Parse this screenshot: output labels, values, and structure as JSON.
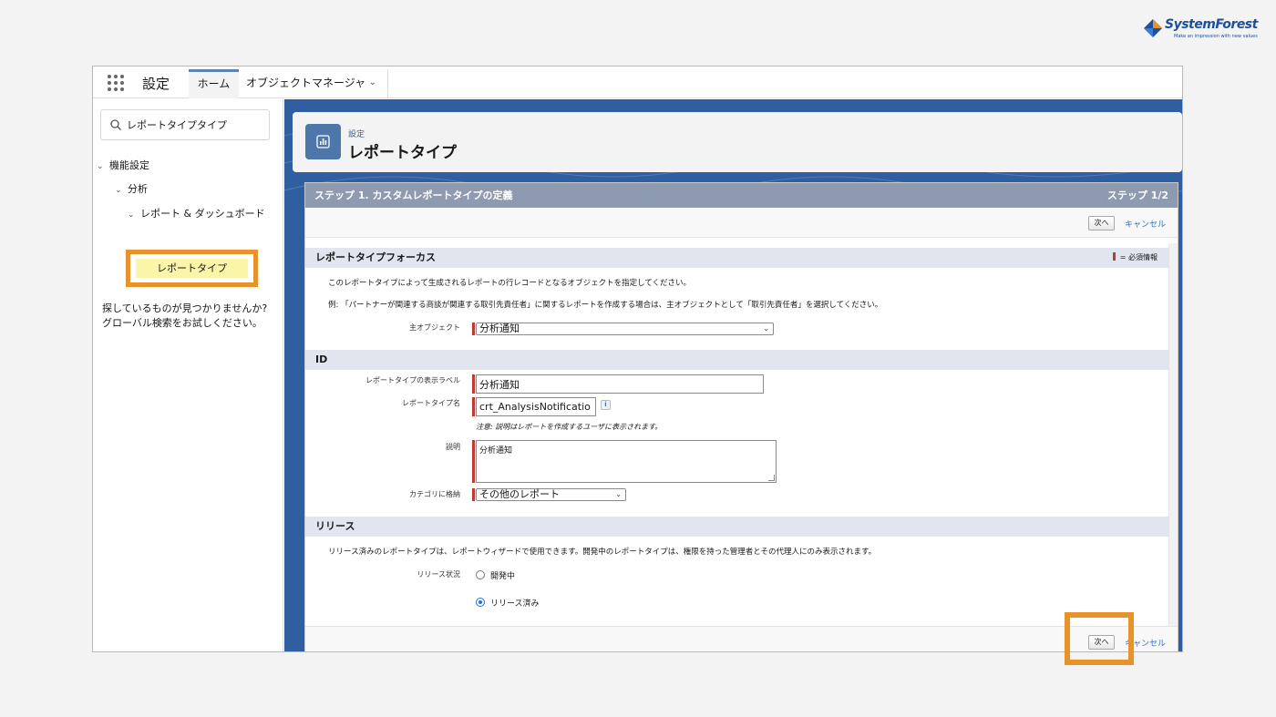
{
  "logo": {
    "name": "SystemForest",
    "tagline": "Make an impression with new values"
  },
  "topbar": {
    "app_title": "設定",
    "tab_home": "ホーム",
    "tab_object_manager": "オブジェクトマネージャ"
  },
  "sidebar": {
    "search_value": "レポートタイプタイプ",
    "tree": {
      "feature_settings": "機能設定",
      "analytics": "分析",
      "reports_dashboards": "レポート & ダッシュボード",
      "report_types": "レポートタイプ"
    },
    "not_found_line1": "探しているものが見つかりませんか?",
    "not_found_line2": "グローバル検索をお試しください。"
  },
  "header": {
    "breadcrumb": "設定",
    "title": "レポートタイプ"
  },
  "wizard": {
    "step_title": "ステップ 1. カスタムレポートタイプの定義",
    "step_count": "ステップ 1/2",
    "next_label": "次へ",
    "cancel_label": "キャンセル",
    "required_legend": "= 必須情報",
    "focus_section": {
      "title": "レポートタイプフォーカス",
      "desc1": "このレポートタイプによって生成されるレポートの行レコードとなるオブジェクトを指定してください。",
      "desc2": "例: 「パートナーが関連する商談が関連する取引先責任者」に関するレポートを作成する場合は、主オブジェクトとして「取引先責任者」を選択してください。",
      "primary_object_label": "主オブジェクト",
      "primary_object_value": "分析通知"
    },
    "id_section": {
      "title": "ID",
      "display_label_label": "レポートタイプの表示ラベル",
      "display_label_value": "分析通知",
      "name_label": "レポートタイプ名",
      "name_value": "crt_AnalysisNotificatio",
      "note": "注意: 説明はレポートを作成するユーザに表示されます。",
      "description_label": "説明",
      "description_value": "分析通知",
      "category_label": "カテゴリに格納",
      "category_value": "その他のレポート"
    },
    "release_section": {
      "title": "リリース",
      "desc": "リリース済みのレポートタイプは、レポートウィザードで使用できます。開発中のレポートタイプは、権限を持った管理者とその代理人にのみ表示されます。",
      "status_label": "リリース状況",
      "option_dev": "開発中",
      "option_released": "リリース済み",
      "selected": "released"
    }
  },
  "colors": {
    "accent": "#e8922c",
    "brand": "#2f5fa0",
    "required": "#c23934"
  }
}
